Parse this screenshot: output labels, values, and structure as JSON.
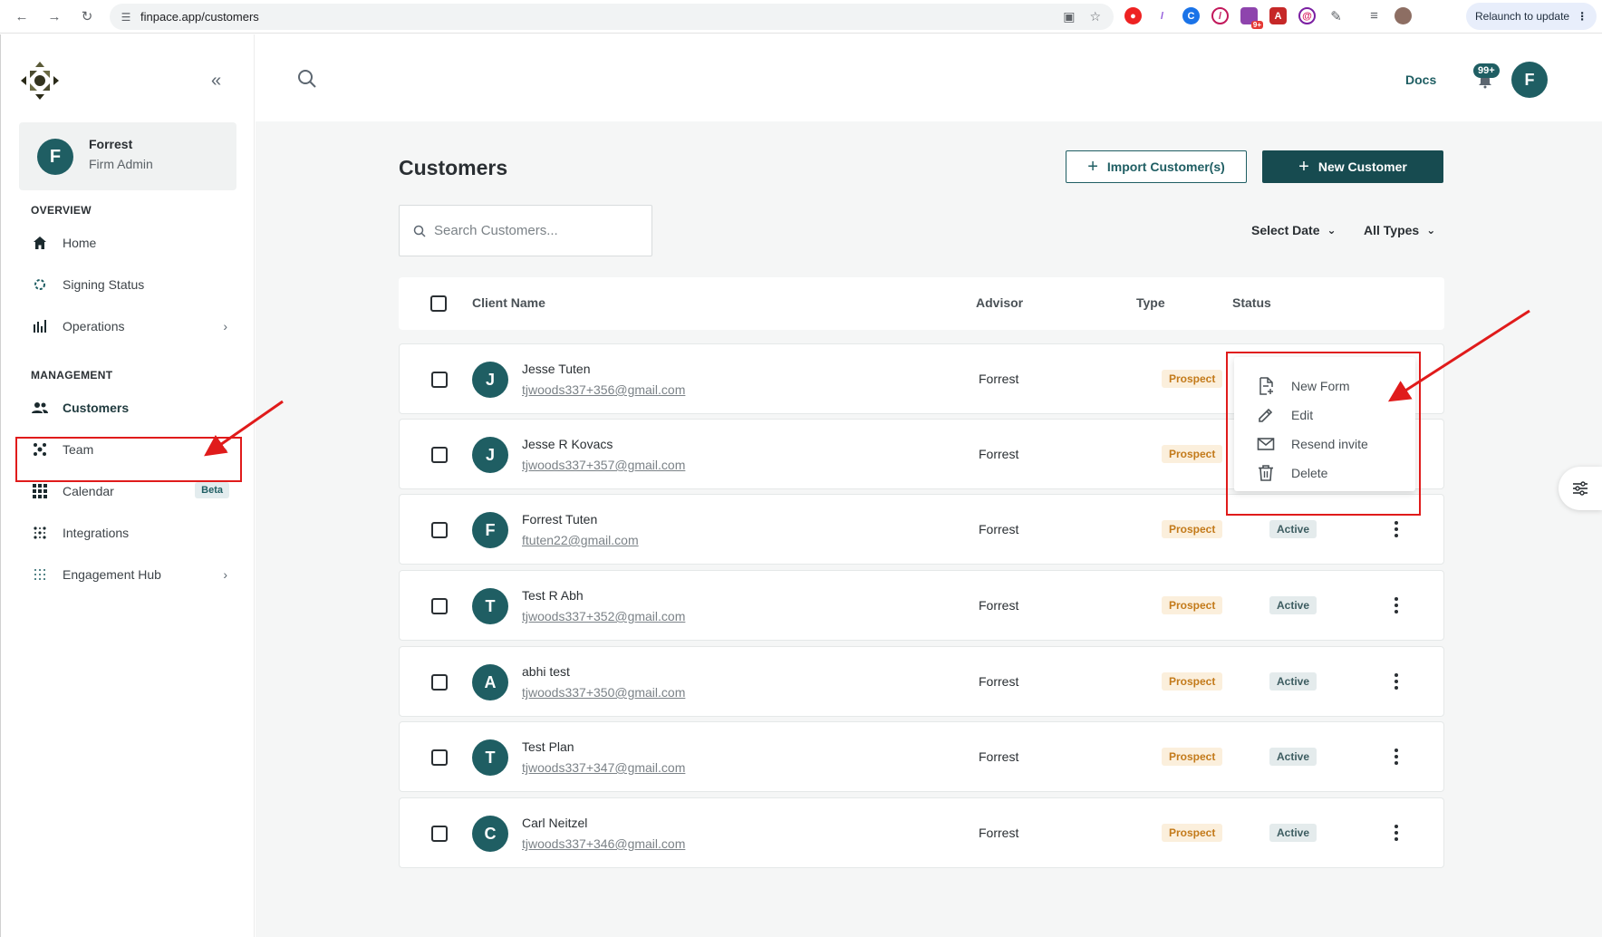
{
  "browser": {
    "url": "finpace.app/customers",
    "relaunch_label": "Relaunch to update",
    "ext_badge": "9+"
  },
  "sidebar": {
    "profile": {
      "initial": "F",
      "name": "Forrest",
      "role": "Firm Admin"
    },
    "sections": {
      "overview": "OVERVIEW",
      "management": "MANAGEMENT"
    },
    "items": [
      {
        "label": "Home",
        "icon": "home-icon"
      },
      {
        "label": "Signing Status",
        "icon": "spinner-icon"
      },
      {
        "label": "Operations",
        "icon": "bar-chart-icon"
      },
      {
        "label": "Customers",
        "icon": "users-icon"
      },
      {
        "label": "Team",
        "icon": "team-icon"
      },
      {
        "label": "Calendar",
        "icon": "grid-icon",
        "badge": "Beta"
      },
      {
        "label": "Integrations",
        "icon": "dots-icon"
      },
      {
        "label": "Engagement Hub",
        "icon": "dot-grid-icon"
      }
    ]
  },
  "header": {
    "docs_label": "Docs",
    "notification_count": "99+",
    "avatar_initial": "F"
  },
  "main": {
    "title": "Customers",
    "import_label": "Import Customer(s)",
    "new_label": "New Customer",
    "search_placeholder": "Search Customers...",
    "filters": {
      "date": "Select Date",
      "types": "All Types"
    },
    "columns": {
      "client": "Client Name",
      "advisor": "Advisor",
      "type": "Type",
      "status": "Status"
    },
    "rows": [
      {
        "initial": "J",
        "name": "Jesse Tuten",
        "email": "tjwoods337+356@gmail.com",
        "advisor": "Forrest",
        "type": "Prospect",
        "status": ""
      },
      {
        "initial": "J",
        "name": "Jesse R Kovacs",
        "email": "tjwoods337+357@gmail.com",
        "advisor": "Forrest",
        "type": "Prospect",
        "status": ""
      },
      {
        "initial": "F",
        "name": "Forrest Tuten",
        "email": "ftuten22@gmail.com",
        "advisor": "Forrest",
        "type": "Prospect",
        "status": "Active"
      },
      {
        "initial": "T",
        "name": "Test R Abh",
        "email": "tjwoods337+352@gmail.com",
        "advisor": "Forrest",
        "type": "Prospect",
        "status": "Active"
      },
      {
        "initial": "A",
        "name": "abhi test",
        "email": "tjwoods337+350@gmail.com",
        "advisor": "Forrest",
        "type": "Prospect",
        "status": "Active"
      },
      {
        "initial": "T",
        "name": "Test Plan",
        "email": "tjwoods337+347@gmail.com",
        "advisor": "Forrest",
        "type": "Prospect",
        "status": "Active"
      },
      {
        "initial": "C",
        "name": "Carl Neitzel",
        "email": "tjwoods337+346@gmail.com",
        "advisor": "Forrest",
        "type": "Prospect",
        "status": "Active"
      }
    ]
  },
  "context_menu": {
    "items": [
      {
        "label": "New Form",
        "icon": "new-form-icon"
      },
      {
        "label": "Edit",
        "icon": "pencil-icon"
      },
      {
        "label": "Resend invite",
        "icon": "mail-icon"
      },
      {
        "label": "Delete",
        "icon": "trash-icon"
      }
    ]
  },
  "colors": {
    "brand": "#1f5e63",
    "annotation": "#e01b1b"
  }
}
